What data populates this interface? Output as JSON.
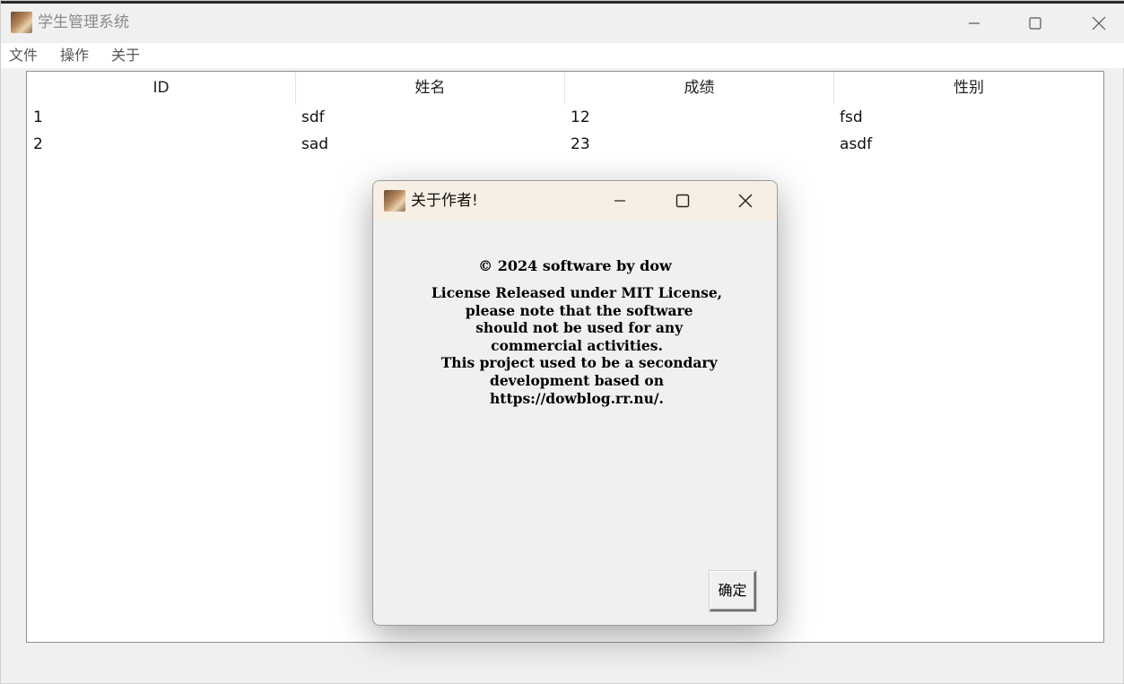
{
  "window": {
    "title": "学生管理系统"
  },
  "menu": {
    "items": [
      "文件",
      "操作",
      "关于"
    ]
  },
  "table": {
    "headers": [
      "ID",
      "姓名",
      "成绩",
      "性别"
    ],
    "rows": [
      [
        "1",
        "sdf",
        "12",
        "fsd"
      ],
      [
        "2",
        "sad",
        "23",
        "asdf"
      ]
    ]
  },
  "dialog": {
    "title": "关于作者!",
    "copyright": "© 2024 software by dow",
    "license": "License Released under MIT License,\n please note that the software\n should not be used for any\ncommercial activities.\n This project used to be a secondary\ndevelopment based on\nhttps://dowblog.rr.nu/.",
    "ok_label": "确定"
  },
  "icons": {
    "app": "app-icon",
    "minimize": "minimize-icon",
    "maximize": "maximize-icon",
    "close": "close-icon"
  }
}
